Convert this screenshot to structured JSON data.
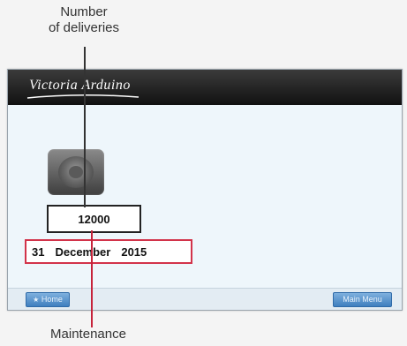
{
  "callouts": {
    "deliveries": "Number\nof deliveries",
    "maintenance": "Maintenance"
  },
  "header": {
    "logo": "Victoria Arduino"
  },
  "device": {
    "delivery_count": "12000",
    "maintenance_day": "31",
    "maintenance_month": "December",
    "maintenance_year": "2015"
  },
  "footer": {
    "home_label": "Home",
    "menu_label": "Main Menu"
  },
  "colors": {
    "maintenance_border": "#d2334a",
    "header": "#1b1b1b",
    "button": "#3f7fbf"
  },
  "icons": {
    "app": "coffee-group-icon",
    "home": "home-icon"
  }
}
